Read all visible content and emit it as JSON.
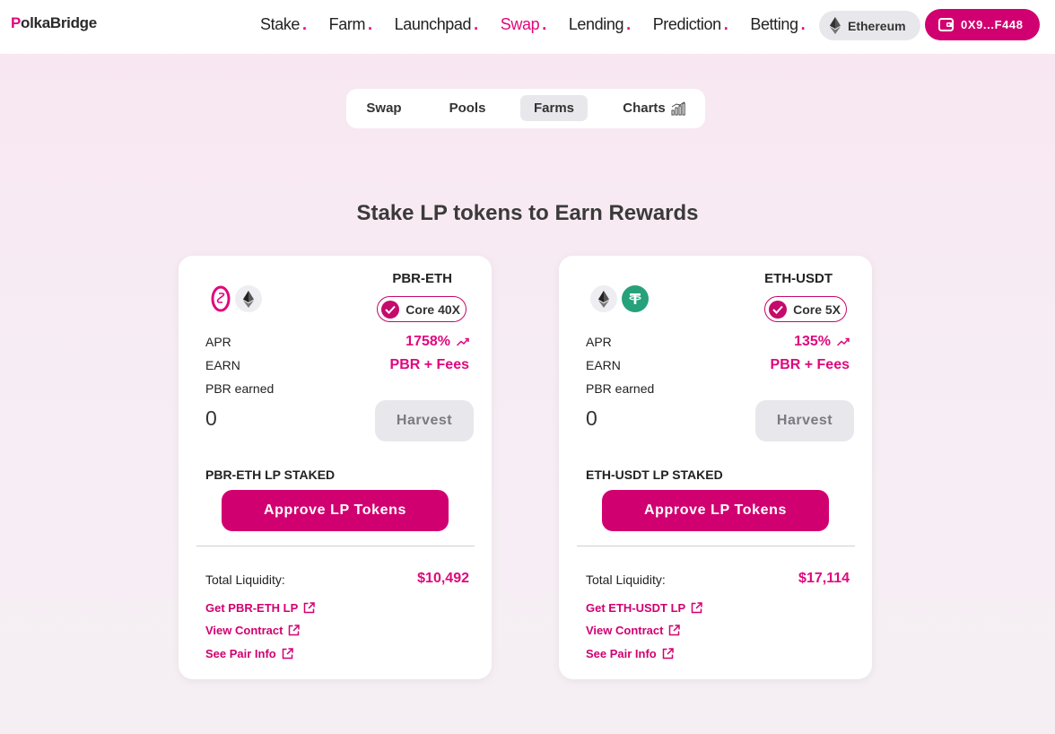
{
  "brand": {
    "logo_p": "P",
    "logo_rest": "olkaBridge",
    "accent": "#d10070",
    "link_color": "#e0077d"
  },
  "nav": [
    {
      "label": "Stake",
      "active": false
    },
    {
      "label": "Farm",
      "active": false
    },
    {
      "label": "Launchpad",
      "active": false
    },
    {
      "label": "Swap",
      "active": true
    },
    {
      "label": "Lending",
      "active": false
    },
    {
      "label": "Prediction",
      "active": false
    },
    {
      "label": "Betting",
      "active": false
    }
  ],
  "network": {
    "label": "Ethereum",
    "icon": "ethereum-icon"
  },
  "wallet": {
    "label": "0X9...F448",
    "icon": "wallet-icon"
  },
  "tabs": {
    "swap": "Swap",
    "pools": "Pools",
    "farms": "Farms",
    "charts": "Charts",
    "active": "farms"
  },
  "page_title": "Stake LP tokens to Earn Rewards",
  "cards": [
    {
      "pair": "PBR-ETH",
      "badge": "Core 40X",
      "tokens": [
        "polkabridge-icon",
        "ethereum-icon"
      ],
      "apr_label": "APR",
      "apr_value": "1758%",
      "earn_label": "EARN",
      "earn_value": "PBR + Fees",
      "earned_label": "PBR earned",
      "earned_value": "0",
      "harvest": "Harvest",
      "staked_label": "PBR-ETH LP STAKED",
      "approve": "Approve LP Tokens",
      "liquidity_label": "Total Liquidity:",
      "liquidity_value": "$10,492",
      "links": {
        "get_lp": "Get PBR-ETH LP",
        "view_contract": "View Contract",
        "pair_info": "See Pair Info"
      }
    },
    {
      "pair": "ETH-USDT",
      "badge": "Core 5X",
      "tokens": [
        "ethereum-icon",
        "tether-icon"
      ],
      "apr_label": "APR",
      "apr_value": "135%",
      "earn_label": "EARN",
      "earn_value": "PBR + Fees",
      "earned_label": "PBR earned",
      "earned_value": "0",
      "harvest": "Harvest",
      "staked_label": "ETH-USDT LP STAKED",
      "approve": "Approve LP Tokens",
      "liquidity_label": "Total Liquidity:",
      "liquidity_value": "$17,114",
      "links": {
        "get_lp": "Get ETH-USDT LP",
        "view_contract": "View Contract",
        "pair_info": "See Pair Info"
      }
    }
  ]
}
